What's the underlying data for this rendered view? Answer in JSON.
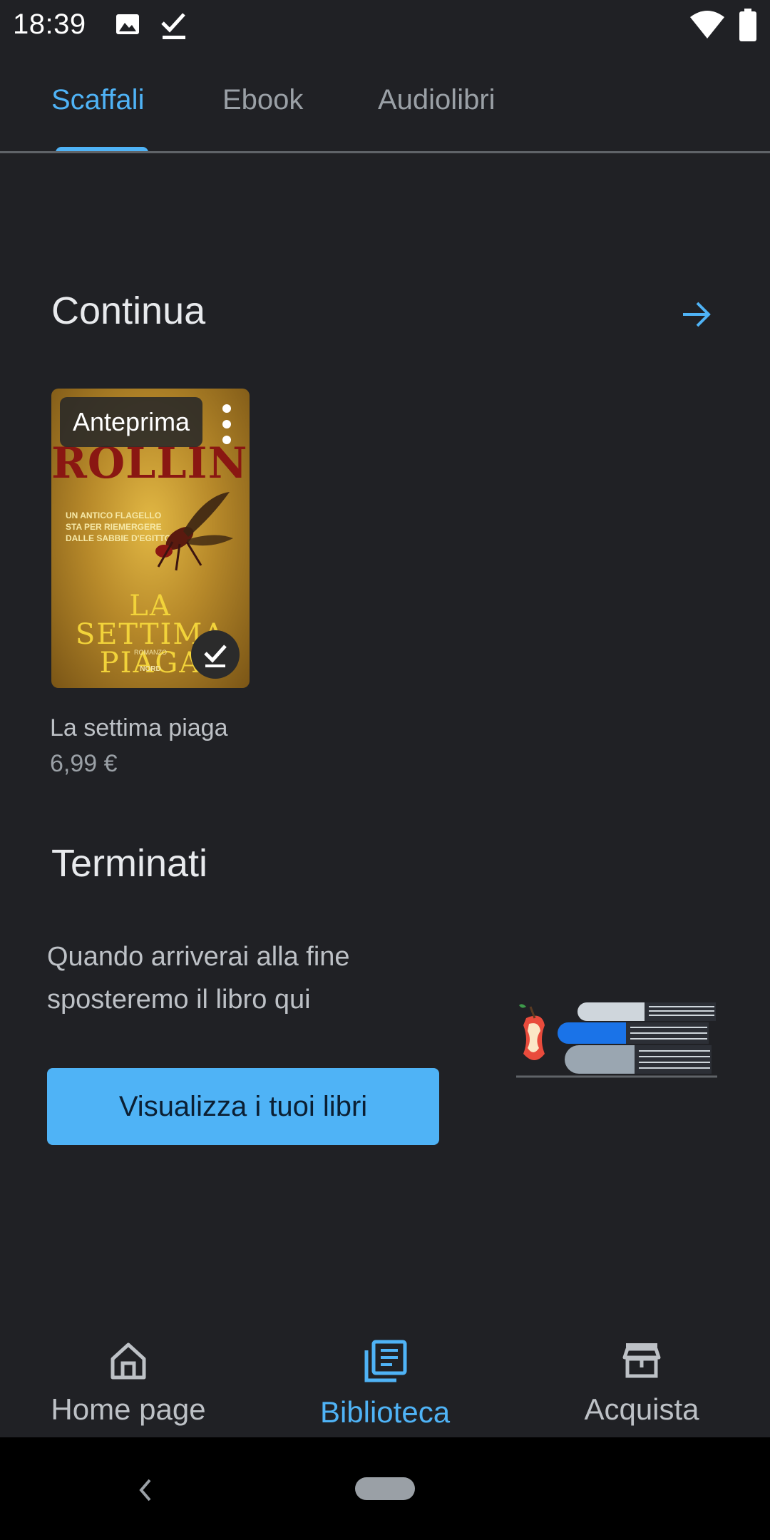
{
  "status_bar": {
    "time": "18:39"
  },
  "tabs": [
    {
      "label": "Scaffali",
      "active": true
    },
    {
      "label": "Ebook",
      "active": false
    },
    {
      "label": "Audiolibri",
      "active": false
    }
  ],
  "continue_section": {
    "title": "Continua",
    "book": {
      "badge": "Anteprima",
      "cover_author": "ROLLINS",
      "cover_tagline": [
        "UN ANTICO FLAGELLO",
        "STA PER RIEMERGERE",
        "DALLE SABBIE D'EGITTO"
      ],
      "cover_title_line1": "LA SETTIMA",
      "cover_title_line2": "PIAGA",
      "cover_genre": "ROMANZO",
      "cover_publisher": "NORD",
      "title": "La settima piaga",
      "price": "6,99 €"
    }
  },
  "finished_section": {
    "title": "Terminati",
    "empty_line1": "Quando arriverai alla fine",
    "empty_line2": "sposteremo il libro qui",
    "button_label": "Visualizza i tuoi libri"
  },
  "bottom_nav": [
    {
      "label": "Home page",
      "icon": "home-icon",
      "active": false
    },
    {
      "label": "Biblioteca",
      "icon": "library-icon",
      "active": true
    },
    {
      "label": "Acquista",
      "icon": "store-icon",
      "active": false
    }
  ],
  "colors": {
    "background": "#202125",
    "accent": "#4fb3f6",
    "text_primary": "#e8eaed",
    "text_secondary": "#bdc1c6"
  }
}
